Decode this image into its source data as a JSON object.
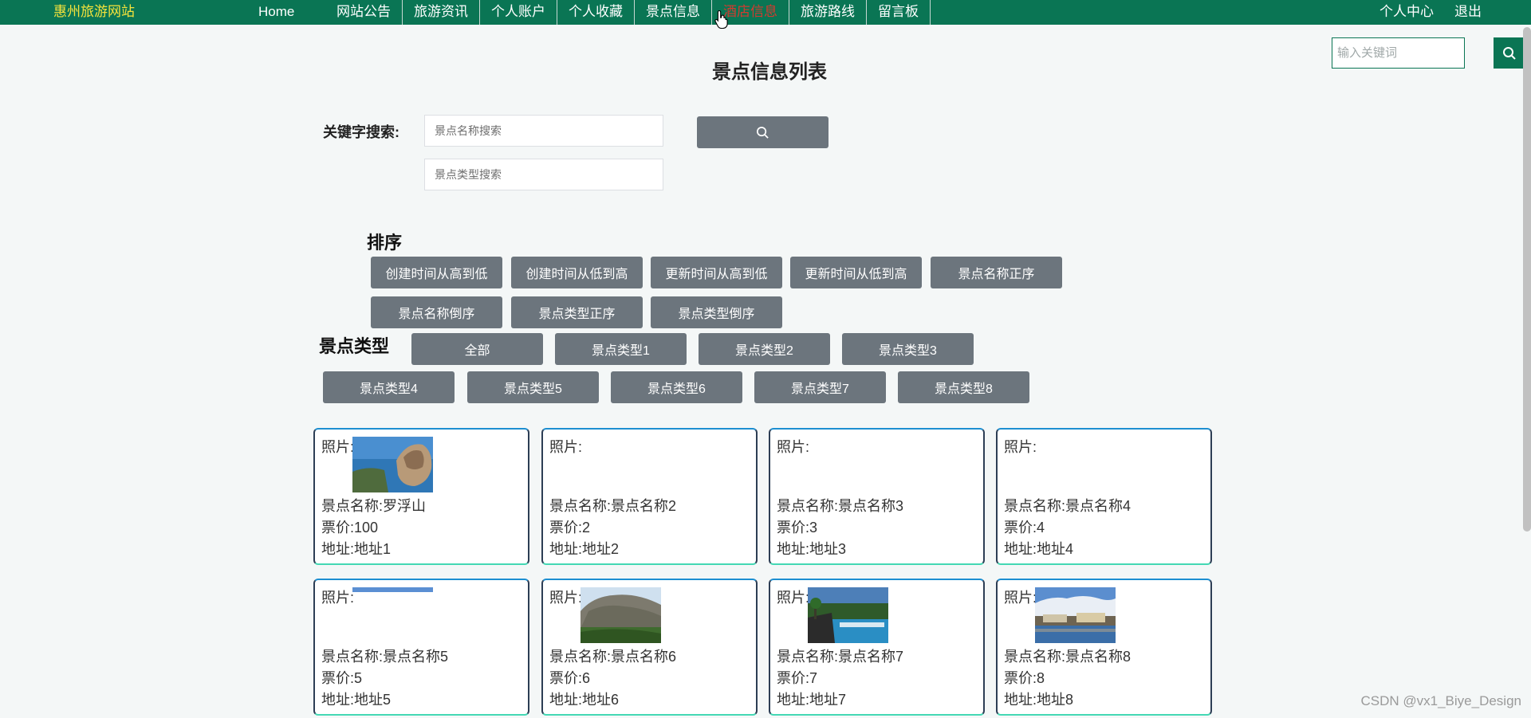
{
  "navbar": {
    "brand": "惠州旅游网站",
    "home": "Home",
    "items": [
      "网站公告",
      "旅游资讯",
      "个人账户",
      "个人收藏",
      "景点信息",
      "酒店信息",
      "旅游路线",
      "留言板"
    ],
    "active_index": 5,
    "right": [
      "个人中心",
      "退出"
    ]
  },
  "top_search": {
    "placeholder": "输入关键词"
  },
  "page_title": "景点信息列表",
  "keyword_search": {
    "label": "关键字搜索:",
    "name_placeholder": "景点名称搜索",
    "type_placeholder": "景点类型搜索"
  },
  "sort": {
    "label": "排序",
    "buttons": [
      "创建时间从高到低",
      "创建时间从低到高",
      "更新时间从高到低",
      "更新时间从低到高",
      "景点名称正序",
      "景点名称倒序",
      "景点类型正序",
      "景点类型倒序"
    ]
  },
  "types": {
    "label": "景点类型",
    "buttons": [
      "全部",
      "景点类型1",
      "景点类型2",
      "景点类型3",
      "景点类型4",
      "景点类型5",
      "景点类型6",
      "景点类型7",
      "景点类型8"
    ]
  },
  "cards": [
    {
      "photo_label": "照片:",
      "name": "景点名称:罗浮山",
      "price": "票价:100",
      "address": "地址:地址1",
      "photo": "coastal-rocks"
    },
    {
      "photo_label": "照片:",
      "name": "景点名称:景点名称2",
      "price": "票价:2",
      "address": "地址:地址2",
      "photo": "none"
    },
    {
      "photo_label": "照片:",
      "name": "景点名称:景点名称3",
      "price": "票价:3",
      "address": "地址:地址3",
      "photo": "none"
    },
    {
      "photo_label": "照片:",
      "name": "景点名称:景点名称4",
      "price": "票价:4",
      "address": "地址:地址4",
      "photo": "none"
    },
    {
      "photo_label": "照片:",
      "name": "景点名称:景点名称5",
      "price": "票价:5",
      "address": "地址:地址5",
      "photo": "sky-strip"
    },
    {
      "photo_label": "照片:",
      "name": "景点名称:景点名称6",
      "price": "票价:6",
      "address": "地址:地址6",
      "photo": "mountain"
    },
    {
      "photo_label": "照片:",
      "name": "景点名称:景点名称7",
      "price": "票价:7",
      "address": "地址:地址7",
      "photo": "resort-pool"
    },
    {
      "photo_label": "照片:",
      "name": "景点名称:景点名称8",
      "price": "票价:8",
      "address": "地址:地址8",
      "photo": "lake-town"
    }
  ],
  "watermark": "CSDN @vx1_Biye_Design",
  "colors": {
    "nav_bg": "#0a7554",
    "brand": "#f5e33b",
    "active": "#d33a2f",
    "button_gray": "#6c757d"
  }
}
